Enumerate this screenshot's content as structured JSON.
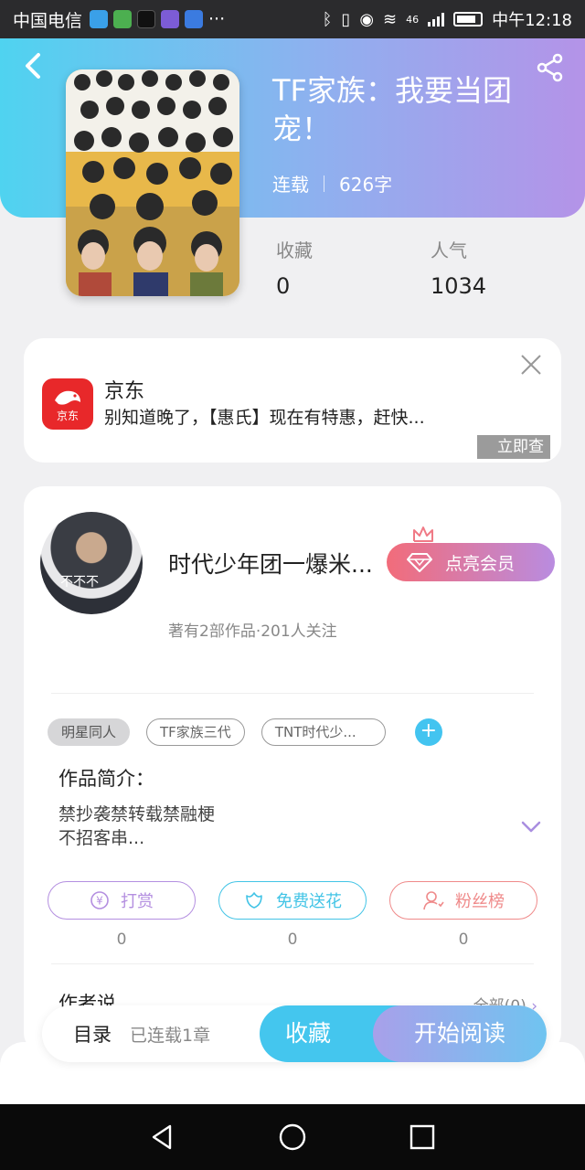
{
  "status_bar": {
    "carrier": "中国电信",
    "network": "46",
    "time": "中午12:18",
    "app_icon_colors": [
      "#3aa0e8",
      "#4caf50",
      "#111111",
      "#7c5cd6",
      "#3b7be0"
    ]
  },
  "header": {
    "title": "TF家族：我要当团宠！",
    "status": "连载",
    "word_count": "626字",
    "stats": [
      {
        "label": "收藏",
        "value": "0"
      },
      {
        "label": "人气",
        "value": "1034"
      }
    ],
    "gradient": [
      "#4fd3f0",
      "#b493e8"
    ]
  },
  "ad": {
    "brand": "京东",
    "logo_text": "京东",
    "text": "别知道晚了，【惠氏】现在有特惠，赶快...",
    "cta": "立即查"
  },
  "author": {
    "name": "时代少年团一爆米...",
    "avatar_caption": "不不不",
    "vip_button": "点亮会员",
    "subtitle": "著有2部作品·201人关注"
  },
  "tags": [
    "明星同人",
    "TF家族三代",
    "TNT时代少..."
  ],
  "intro": {
    "title": "作品简介：",
    "lines": [
      "禁抄袭禁转载禁融梗",
      "不招客串..."
    ]
  },
  "actions": [
    {
      "label": "打赏",
      "count": "0",
      "color": "#b48fe0",
      "icon": "coin-icon"
    },
    {
      "label": "免费送花",
      "count": "0",
      "color": "#43c4e6",
      "icon": "flower-icon"
    },
    {
      "label": "粉丝榜",
      "count": "0",
      "color": "#ef8a8a",
      "icon": "fans-icon"
    }
  ],
  "author_says": {
    "title": "作者说",
    "all_link": "全部(0)"
  },
  "bottom_bar": {
    "toc_label": "目录",
    "toc_status": "已连载1章",
    "favorite": "收藏",
    "start_reading": "开始阅读"
  }
}
